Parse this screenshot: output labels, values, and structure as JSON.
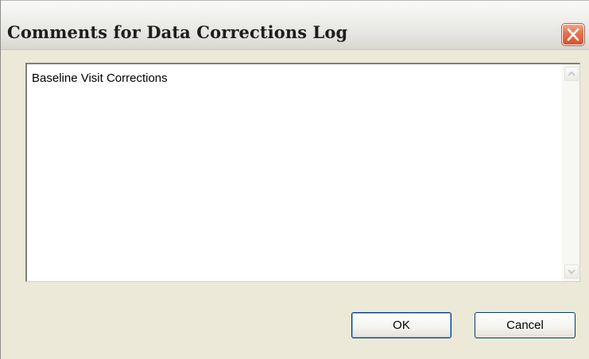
{
  "window": {
    "title": "Comments for Data Corrections Log",
    "close_icon": "close-icon"
  },
  "comments": {
    "text": "Baseline Visit Corrections",
    "scroll_up_icon": "chevron-up-icon",
    "scroll_down_icon": "chevron-down-icon"
  },
  "buttons": {
    "ok_label": "OK",
    "cancel_label": "Cancel"
  },
  "colors": {
    "dialog_bg": "#ECE9D8",
    "close_red": "#E4714F",
    "button_border": "#003C74"
  }
}
